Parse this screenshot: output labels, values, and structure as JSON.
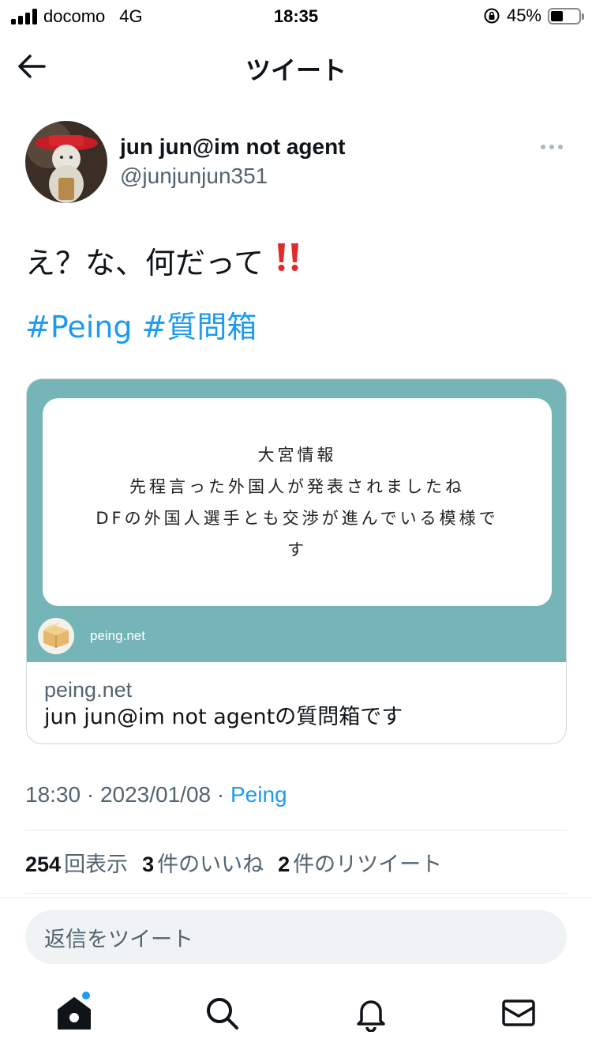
{
  "status_bar": {
    "carrier": "docomo",
    "network": "4G",
    "time": "18:35",
    "battery": "45%",
    "battery_level": 0.45
  },
  "header": {
    "title": "ツイート",
    "back_icon": "arrow-left-icon"
  },
  "author": {
    "name": "jun jun@im not agent",
    "handle": "@junjunjun351",
    "more_icon": "more-horizontal-icon"
  },
  "tweet": {
    "text": "え？な、何だって",
    "emoji": "‼️",
    "hashtags": [
      "#Peing",
      "#質問箱"
    ]
  },
  "card": {
    "image_lines": [
      "大宮情報",
      "先程言った外国人が発表されましたね",
      "DFの外国人選手とも交渉が進んでいる模様で",
      "す"
    ],
    "image_domain": "peing.net",
    "domain": "peing.net",
    "title": "jun jun@im not agentの質問箱です",
    "bg_color": "#76b5b7"
  },
  "meta": {
    "time": "18:30",
    "sep1": " · ",
    "date": "2023/01/08",
    "sep2": " · ",
    "source": "Peing"
  },
  "stats": {
    "views_count": "254",
    "views_label": "回表示",
    "likes_count": "3",
    "likes_label": "件のいいね",
    "retweets_count": "2",
    "retweets_label": "件のリツイート"
  },
  "reply": {
    "placeholder": "返信をツイート"
  },
  "tabs": [
    {
      "icon": "home-icon"
    },
    {
      "icon": "search-icon"
    },
    {
      "icon": "notifications-icon"
    },
    {
      "icon": "messages-icon"
    }
  ],
  "colors": {
    "accent": "#1d9bf0",
    "text": "#0f1419",
    "secondary": "#536471"
  }
}
